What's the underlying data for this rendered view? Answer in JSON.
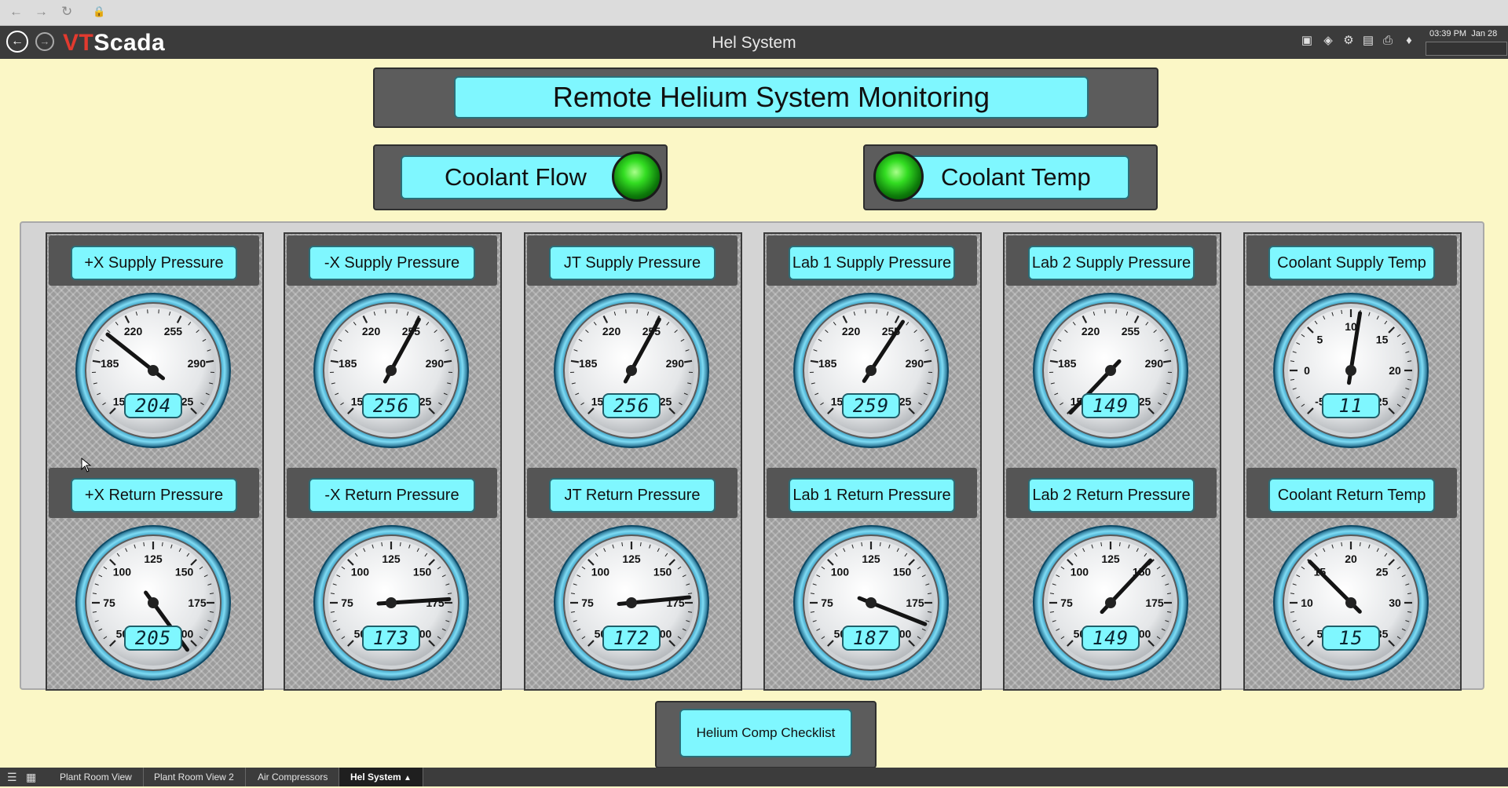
{
  "browser": {
    "back_icon": "back-arrow-icon",
    "forward_icon": "forward-arrow-icon",
    "reload_icon": "reload-icon",
    "lock_icon": "lock-icon"
  },
  "app": {
    "logo_vt": "VT",
    "logo_rest": "Scada",
    "title": "Hel System",
    "clock_time": "03:39 PM",
    "clock_date": "Jan 28",
    "header_icons": [
      "image-icon",
      "tag-icon",
      "settings-icon",
      "report-icon",
      "print-icon",
      "alarm-bell-icon"
    ]
  },
  "main": {
    "title": "Remote Helium System Monitoring",
    "flow_label": "Coolant Flow",
    "temp_label": "Coolant Temp",
    "checklist_button": "Helium Comp Checklist"
  },
  "colors": {
    "background": "#fbf7c6",
    "panel_cyan": "#7ff7ff",
    "led_green": "#33dd22",
    "header": "#3b3b3b"
  },
  "gauges": [
    {
      "label": "+X Supply Pressure",
      "value": 204,
      "readout": "204",
      "ticks": [
        "150",
        "185",
        "220",
        "255",
        "290",
        "325"
      ],
      "min": 150,
      "max": 325
    },
    {
      "label": "+X Return Pressure",
      "value": 205,
      "readout": "205",
      "ticks": [
        "50",
        "75",
        "100",
        "125",
        "150",
        "175",
        "200"
      ],
      "min": 50,
      "max": 200
    },
    {
      "label": "-X Supply Pressure",
      "value": 256,
      "readout": "256",
      "ticks": [
        "150",
        "185",
        "220",
        "255",
        "290",
        "325"
      ],
      "min": 150,
      "max": 325
    },
    {
      "label": "-X Return Pressure",
      "value": 173,
      "readout": "173",
      "ticks": [
        "50",
        "75",
        "100",
        "125",
        "150",
        "175",
        "200"
      ],
      "min": 50,
      "max": 200
    },
    {
      "label": "JT Supply Pressure",
      "value": 256,
      "readout": "256",
      "ticks": [
        "150",
        "185",
        "220",
        "255",
        "290",
        "325"
      ],
      "min": 150,
      "max": 325
    },
    {
      "label": "JT Return Pressure",
      "value": 172,
      "readout": "172",
      "ticks": [
        "50",
        "75",
        "100",
        "125",
        "150",
        "175",
        "200"
      ],
      "min": 50,
      "max": 200
    },
    {
      "label": "Lab 1 Supply Pressure",
      "value": 259,
      "readout": "259",
      "ticks": [
        "150",
        "185",
        "220",
        "255",
        "290",
        "325"
      ],
      "min": 150,
      "max": 325
    },
    {
      "label": "Lab 1 Return Pressure",
      "value": 187,
      "readout": "187",
      "ticks": [
        "50",
        "75",
        "100",
        "125",
        "150",
        "175",
        "200"
      ],
      "min": 50,
      "max": 200
    },
    {
      "label": "Lab 2 Supply Pressure",
      "value": 149,
      "readout": "149",
      "ticks": [
        "150",
        "185",
        "220",
        "255",
        "290",
        "325"
      ],
      "min": 150,
      "max": 325
    },
    {
      "label": "Lab 2 Return Pressure",
      "value": 149,
      "readout": "149",
      "ticks": [
        "50",
        "75",
        "100",
        "125",
        "150",
        "175",
        "200"
      ],
      "min": 50,
      "max": 200
    },
    {
      "label": "Coolant Supply Temp",
      "value": 11,
      "readout": "11",
      "ticks": [
        "-5",
        "0",
        "5",
        "10",
        "15",
        "20",
        "25"
      ],
      "min": -5,
      "max": 25
    },
    {
      "label": "Coolant Return Temp",
      "value": 15,
      "readout": "15",
      "ticks": [
        "5",
        "10",
        "15",
        "20",
        "25",
        "30",
        "35"
      ],
      "min": 5,
      "max": 35
    }
  ],
  "taskbar": {
    "menu_icon": "menu-icon",
    "grid_icon": "grid-view-icon",
    "tabs": [
      "Plant Room View",
      "Plant Room View 2",
      "Air Compressors",
      "Hel System"
    ],
    "active_tab_pin": "pin-icon"
  }
}
